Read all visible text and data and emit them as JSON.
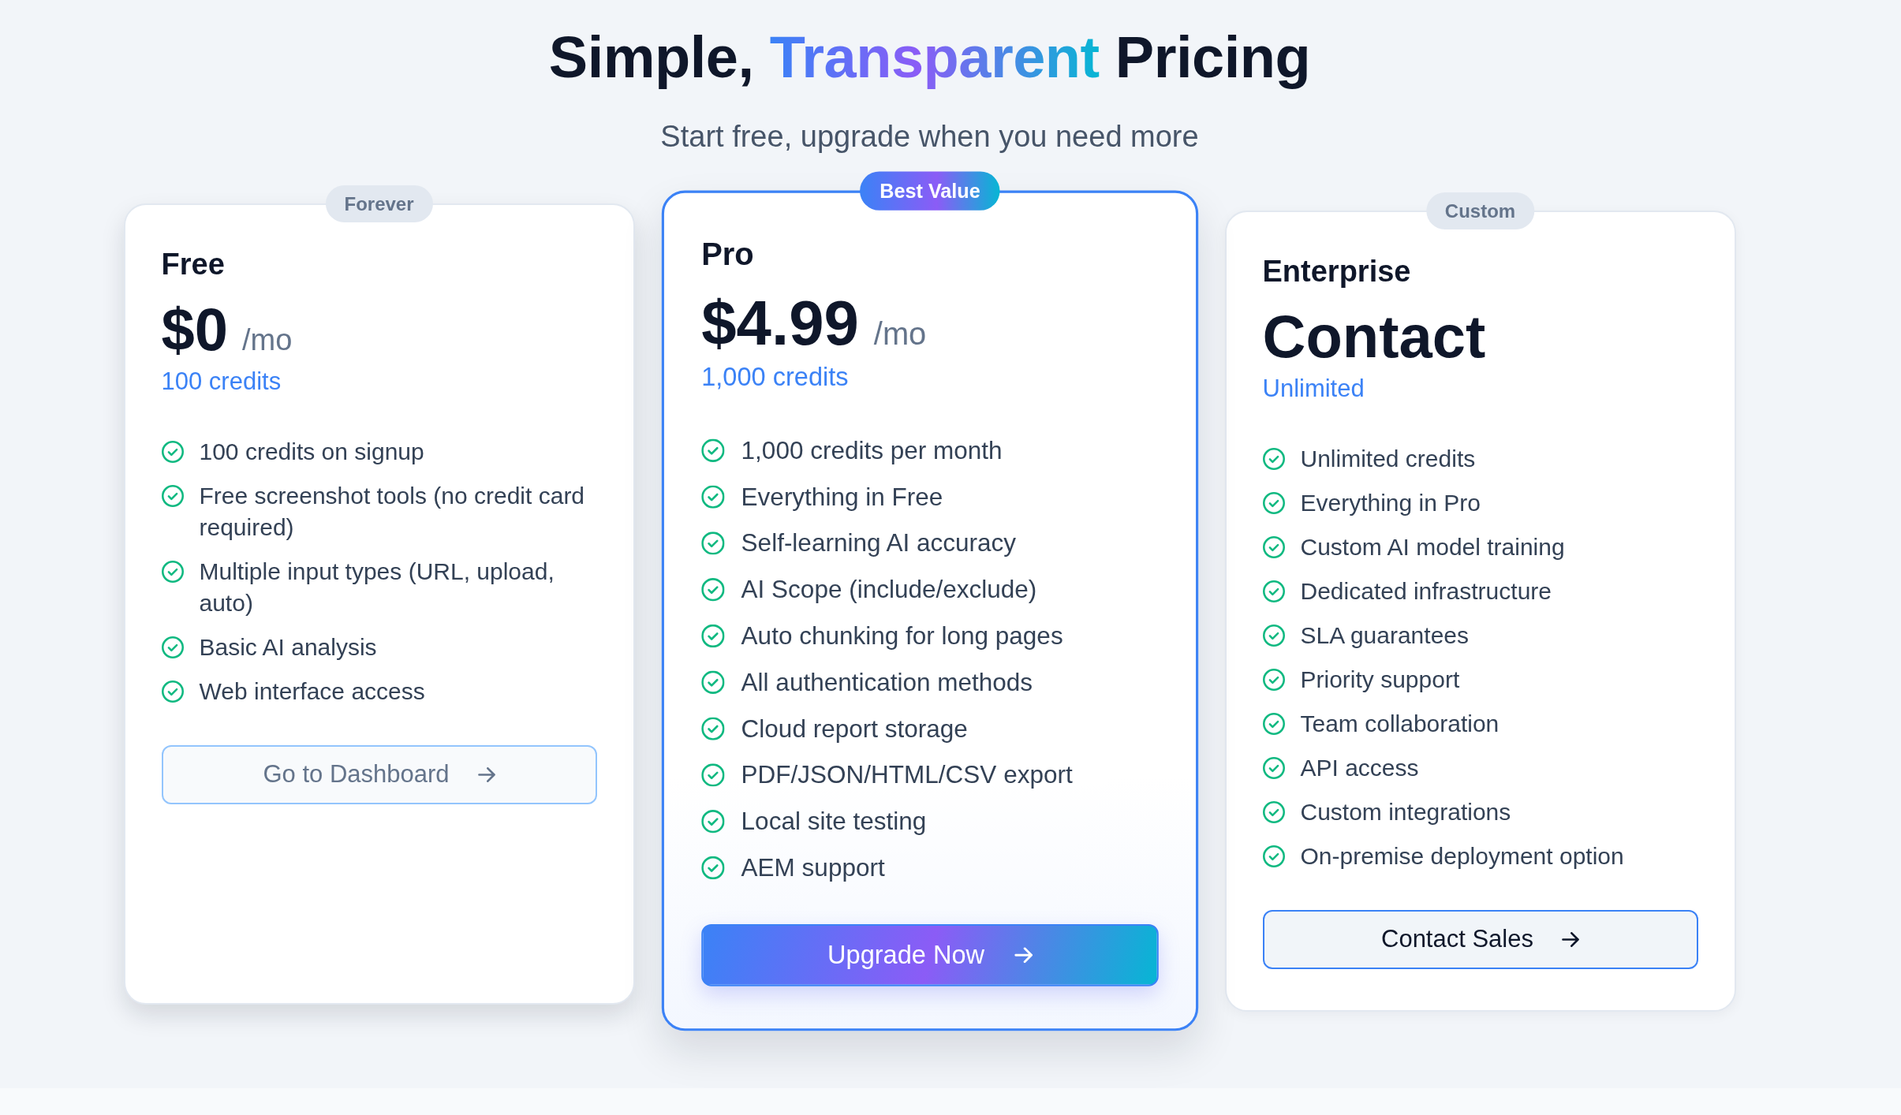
{
  "header": {
    "title_parts": [
      {
        "text": "Simple,",
        "highlight": false
      },
      {
        "text": "Transparent",
        "highlight": true
      },
      {
        "text": "Pricing",
        "highlight": false
      }
    ],
    "subtitle": "Start free, upgrade when you need more"
  },
  "plans": [
    {
      "badge": "Forever",
      "featured": false,
      "hovered": true,
      "name": "Free",
      "price": "$0",
      "period": "/mo",
      "credits": "100 credits",
      "features": [
        "100 credits on signup",
        "Free screenshot tools (no credit card required)",
        "Multiple input types (URL, upload, auto)",
        "Basic AI analysis",
        "Web interface access"
      ],
      "button": {
        "kind": "outline",
        "label": "Go to Dashboard"
      }
    },
    {
      "badge": "Best Value",
      "featured": true,
      "hovered": false,
      "name": "Pro",
      "price": "$4.99",
      "period": "/mo",
      "credits": "1,000 credits",
      "features": [
        "1,000 credits per month",
        "Everything in Free",
        "Self-learning AI accuracy",
        "AI Scope (include/exclude)",
        "Auto chunking for long pages",
        "All authentication methods",
        "Cloud report storage",
        "PDF/JSON/HTML/CSV export",
        "Local site testing",
        "AEM support"
      ],
      "button": {
        "kind": "primary",
        "label": "Upgrade Now"
      }
    },
    {
      "badge": "Custom",
      "featured": false,
      "hovered": false,
      "name": "Enterprise",
      "price": "Contact",
      "credits": "Unlimited",
      "features": [
        "Unlimited credits",
        "Everything in Pro",
        "Custom AI model training",
        "Dedicated infrastructure",
        "SLA guarantees",
        "Priority support",
        "Team collaboration",
        "API access",
        "Custom integrations",
        "On-premise deployment option"
      ],
      "button": {
        "kind": "secondary",
        "label": "Contact Sales"
      }
    }
  ]
}
